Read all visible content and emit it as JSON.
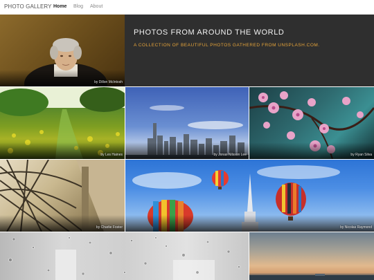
{
  "navbar": {
    "brand": "PHOTO GALLERY",
    "links": [
      {
        "label": "Home",
        "active": true
      },
      {
        "label": "Blog",
        "active": false
      },
      {
        "label": "About",
        "active": false
      }
    ]
  },
  "hero": {
    "title": "PHOTOS FROM AROUND THE WORLD",
    "subtitle": "A COLLECTION OF BEAUTIFUL PHOTOS GATHERED FROM UNSPLASH.COM."
  },
  "photos": {
    "portrait": {
      "credit": "by Dillon McIntosh"
    },
    "meadow": {
      "credit": "by Les Haines"
    },
    "city": {
      "credit": "by Jonas Nilsson Lee"
    },
    "blossom": {
      "credit": "by Ryan Silva"
    },
    "bridge": {
      "credit": "by Charlie Foster"
    },
    "balloons": {
      "credit": "by Nicolas Raymond"
    },
    "rain": {
      "credit": ""
    },
    "sea": {
      "credit": ""
    }
  },
  "colors": {
    "hero_background": "#2f2f2f",
    "accent": "#e6a43a",
    "nav_active": "#222222"
  }
}
